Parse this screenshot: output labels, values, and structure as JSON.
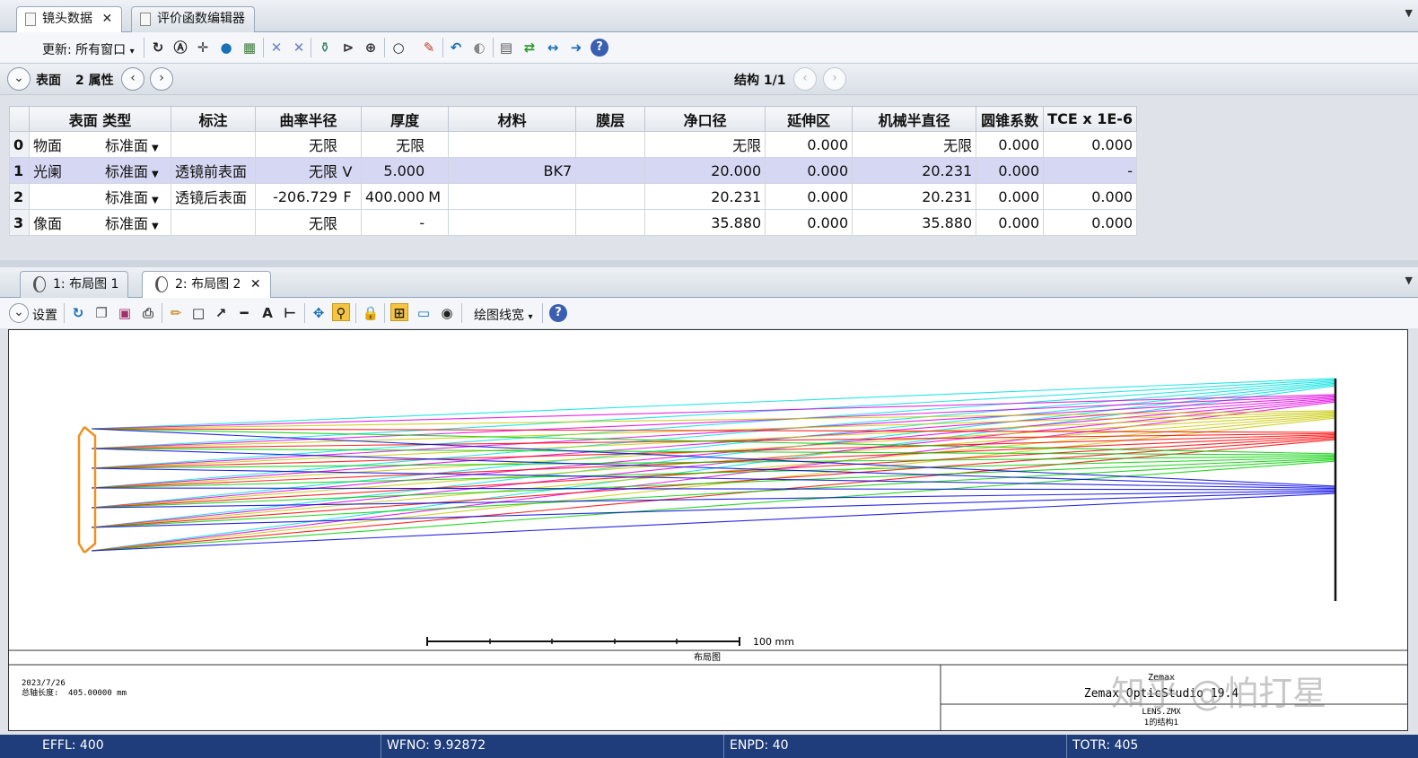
{
  "tabs": [
    {
      "label": "镜头数据",
      "close": "✕"
    },
    {
      "label": "评价函数编辑器"
    }
  ],
  "toolbar1": {
    "update_label": "更新: 所有窗口",
    "dropdown": "▾"
  },
  "nav": {
    "section_label": "表面",
    "props_label": "2 属性",
    "config_label": "结构 1/1"
  },
  "table": {
    "columns": [
      "表面 类型",
      "标注",
      "曲率半径",
      "厚度",
      "材料",
      "膜层",
      "净口径",
      "延伸区",
      "机械半直径",
      "圆锥系数",
      "TCE x 1E-6"
    ],
    "rows": [
      {
        "num": "0",
        "name": "物面",
        "type": "标准面",
        "comment": "",
        "radius": "无限",
        "radius_solve": "",
        "thickness": "无限",
        "thickness_solve": "",
        "material": "",
        "coating": "",
        "clear": "无限",
        "chip": "0.000",
        "mech": "无限",
        "conic": "0.000",
        "tce": "0.000"
      },
      {
        "num": "1",
        "name": "光阑",
        "type": "标准面",
        "comment": "透镜前表面",
        "radius": "无限",
        "radius_solve": "V",
        "thickness": "5.000",
        "thickness_solve": "",
        "material": "BK7",
        "coating": "",
        "clear": "20.000",
        "chip": "0.000",
        "mech": "20.231",
        "conic": "0.000",
        "tce": "-"
      },
      {
        "num": "2",
        "name": "",
        "type": "标准面",
        "comment": "透镜后表面",
        "radius": "-206.729",
        "radius_solve": "F",
        "thickness": "400.000",
        "thickness_solve": "M",
        "material": "",
        "coating": "",
        "clear": "20.231",
        "chip": "0.000",
        "mech": "20.231",
        "conic": "0.000",
        "tce": "0.000"
      },
      {
        "num": "3",
        "name": "像面",
        "type": "标准面",
        "comment": "",
        "radius": "无限",
        "radius_solve": "",
        "thickness": "-",
        "thickness_solve": "",
        "material": "",
        "coating": "",
        "clear": "35.880",
        "chip": "0.000",
        "mech": "35.880",
        "conic": "0.000",
        "tce": "0.000"
      }
    ]
  },
  "tabs2": [
    {
      "label": "1: 布局图 1"
    },
    {
      "label": "2: 布局图 2",
      "close": "✕"
    }
  ],
  "toolbar2": {
    "settings_label": "设置",
    "linewidth_label": "绘图线宽"
  },
  "plot": {
    "scale_label": "100 mm",
    "caption": "布局图",
    "date": "2023/7/26",
    "total_length_label": "总轴长度:",
    "total_length_value": "405.00000 mm",
    "brand_top": "Zemax",
    "brand": "Zemax OpticStudio 19.4",
    "file": "LENS.ZMX",
    "config_text": "1的结构1",
    "watermark": "知乎 @怕打星"
  },
  "colors": {
    "rays": [
      "#00e0e0",
      "#e000e0",
      "#c8c800",
      "#ff0000",
      "#00d000",
      "#0000e0"
    ],
    "status_bg": "#1f3d7a",
    "selection": "#d6d8f3"
  },
  "status": {
    "effl": "EFFL: 400",
    "wfno": "WFNO: 9.92872",
    "enpd": "ENPD: 40",
    "totr": "TOTR: 405"
  }
}
